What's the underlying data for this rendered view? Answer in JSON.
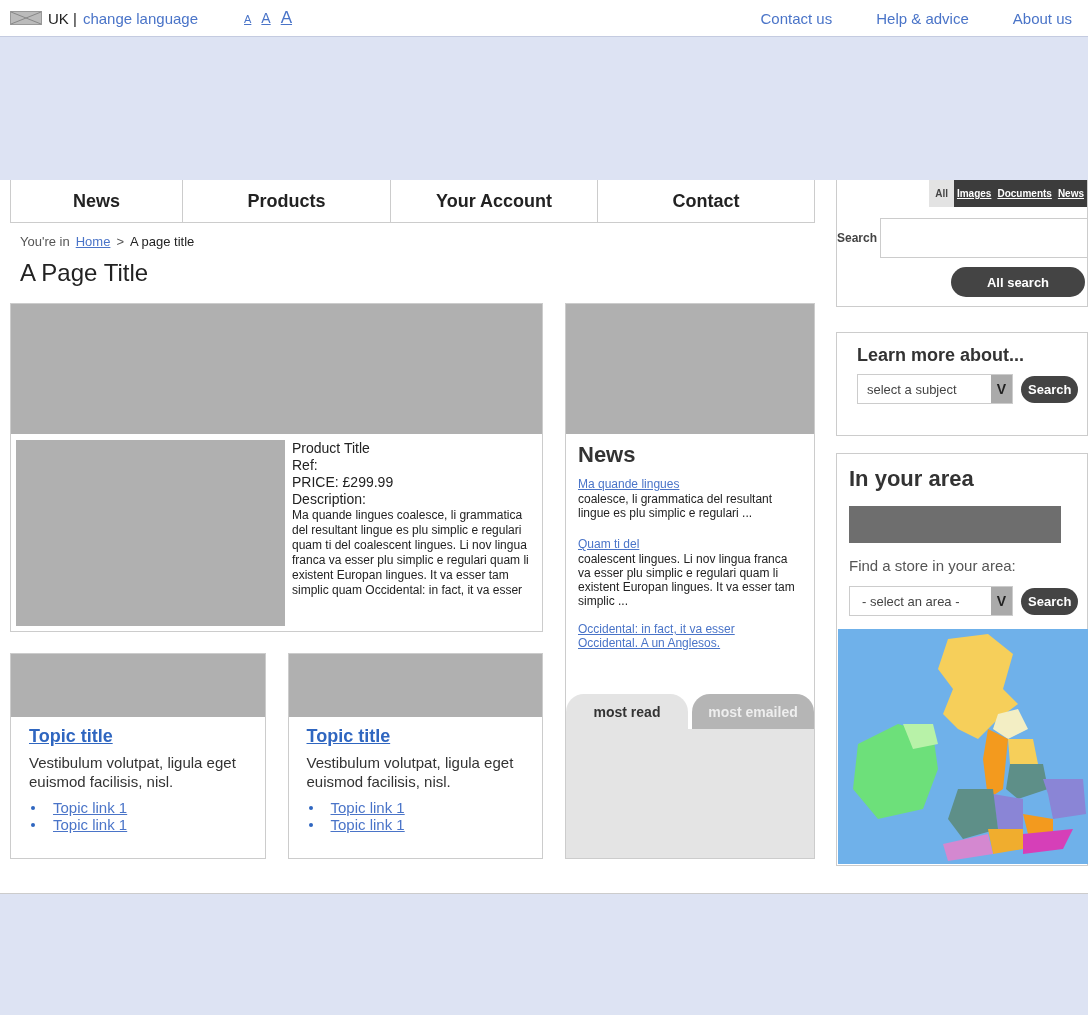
{
  "top_bar": {
    "country": "UK |",
    "language_link": "change language",
    "font_sizes": [
      "A",
      "A",
      "A"
    ],
    "links": [
      "Contact us",
      "Help & advice",
      "About us"
    ]
  },
  "nav": [
    "News",
    "Products",
    "Your Account",
    "Contact"
  ],
  "breadcrumb": {
    "prefix": "You're in",
    "home": "Home",
    "separator": ">",
    "current": "A page title"
  },
  "page_title": "A Page Title",
  "product": {
    "lines": [
      "Product Title",
      "Ref:",
      "PRICE: £299.99",
      "Description:"
    ],
    "description": "Ma quande lingues coalesce, li grammatica del resultant lingue es plu simplic e regulari quam ti del coalescent lingues. Li nov lingua franca va esser plu simplic e regulari quam li existent Europan lingues. It va esser tam simplic quam Occidental: in fact, it va esser"
  },
  "topics": [
    {
      "title": "Topic title",
      "text": "Vestibulum volutpat, ligula eget euismod facilisis, nisl.",
      "links": [
        "Topic link 1",
        "Topic link 1"
      ]
    },
    {
      "title": "Topic title",
      "text": "Vestibulum volutpat, ligula eget euismod facilisis, nisl.",
      "links": [
        "Topic link 1",
        "Topic link 1"
      ]
    }
  ],
  "news": {
    "title": "News",
    "items": [
      {
        "link": "Ma quande lingues",
        "text": "coalesce, li grammatica del resultant lingue es plu simplic e regulari ..."
      },
      {
        "link": "Quam ti del",
        "text": "coalescent lingues. Li nov lingua franca va esser plu simplic e regulari quam li existent Europan lingues. It va esser tam simplic ..."
      },
      {
        "link": "Occidental: in fact, it va esser Occidental. A un Anglesos."
      }
    ],
    "tabs": [
      {
        "label": "most read",
        "selected": true
      },
      {
        "label": "most emailed",
        "selected": false
      }
    ]
  },
  "search": {
    "tabs": [
      {
        "label": "All",
        "selected": true
      },
      {
        "label": "Images",
        "selected": false
      },
      {
        "label": "Documents",
        "selected": false
      },
      {
        "label": "News",
        "selected": false
      }
    ],
    "label": "Search",
    "button": "All search"
  },
  "learn_more": {
    "title": "Learn more about...",
    "select": "select a subject",
    "arrow": "V",
    "button": "Search"
  },
  "area": {
    "title": "In your area",
    "prompt": "Find a store in your area:",
    "select": "- select an area -",
    "arrow": "V",
    "button": "Search"
  }
}
